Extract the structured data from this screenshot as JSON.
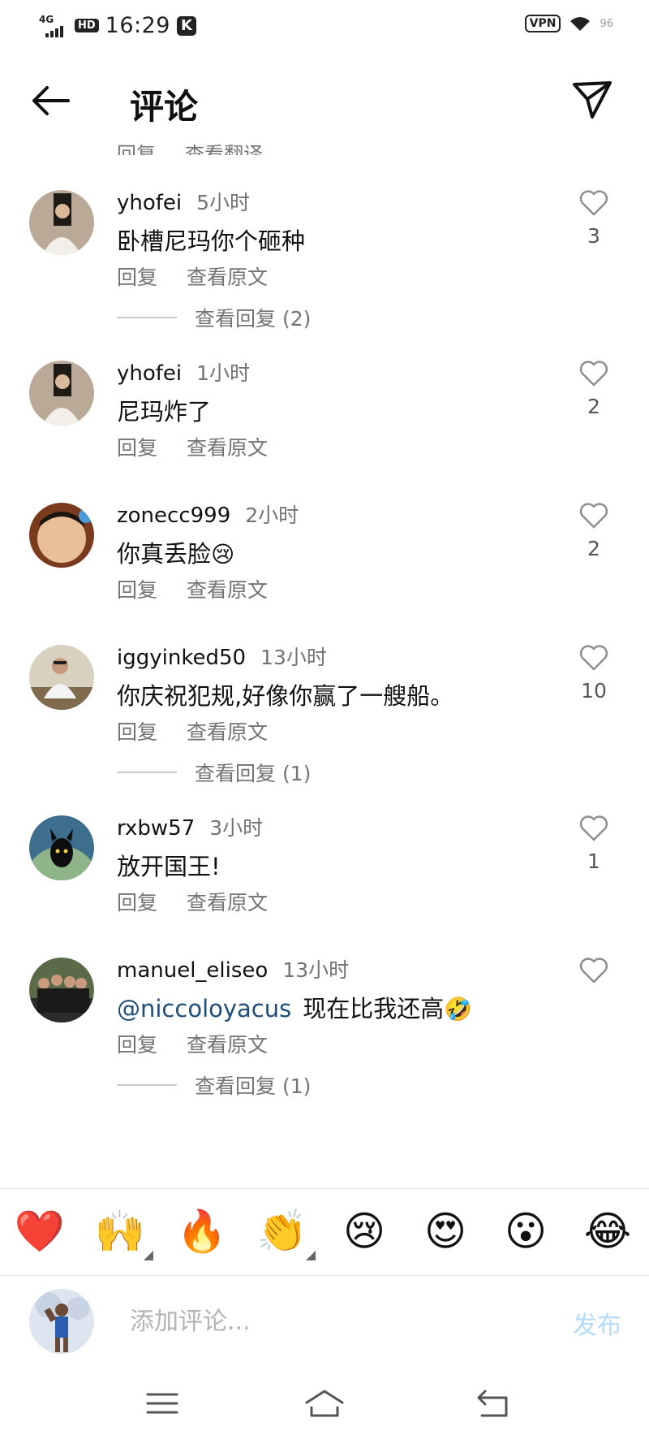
{
  "status_bar": {
    "network": "4G",
    "hd": "HD",
    "time": "16:29",
    "k_badge": "K",
    "vpn": "VPN",
    "battery": "96"
  },
  "header": {
    "title": "评论"
  },
  "partial_comment": {
    "reply": "回复",
    "translate": "查看翻译"
  },
  "comments": [
    {
      "username": "yhofei",
      "time": "5小时",
      "text": "卧槽尼玛你个砸种",
      "mention": "",
      "emoji": "",
      "reply": "回复",
      "view_original": "查看原文",
      "likes": "3"
    },
    {
      "username": "yhofei",
      "time": "1小时",
      "text": "尼玛炸了",
      "mention": "",
      "emoji": "",
      "reply": "回复",
      "view_original": "查看原文",
      "likes": "2"
    },
    {
      "username": "zonecc999",
      "time": "2小时",
      "text": "你真丢脸",
      "mention": "",
      "emoji": "😢",
      "reply": "回复",
      "view_original": "查看原文",
      "likes": "2"
    },
    {
      "username": "iggyinked50",
      "time": "13小时",
      "text": "你庆祝犯规,好像你赢了一艘船。",
      "mention": "",
      "emoji": "",
      "reply": "回复",
      "view_original": "查看原文",
      "likes": "10"
    },
    {
      "username": "rxbw57",
      "time": "3小时",
      "text": "放开国王!",
      "mention": "",
      "emoji": "",
      "reply": "回复",
      "view_original": "查看原文",
      "likes": "1"
    },
    {
      "username": "manuel_eliseo",
      "time": "13小时",
      "text": "现在比我还高",
      "mention": "@niccoloyacus",
      "emoji": "🤣",
      "reply": "回复",
      "view_original": "查看原文",
      "likes": ""
    }
  ],
  "view_replies": [
    "查看回复 (2)",
    "查看回复 (1)",
    "查看回复 (1)"
  ],
  "emoji_bar": [
    "❤️",
    "🙌",
    "🔥",
    "👏",
    "😢",
    "😍",
    "😮",
    "😂"
  ],
  "input": {
    "placeholder": "添加评论...",
    "publish_label": "发布"
  },
  "colors": {
    "secondary_text": "#737373",
    "mention": "#1f4e79",
    "publish_disabled": "#b3dbfb"
  },
  "icons": {
    "back": "arrow-left-icon",
    "send": "paper-plane-icon",
    "like": "heart-outline-icon",
    "nav_menu": "menu-icon",
    "nav_home": "home-icon",
    "nav_back": "return-icon"
  }
}
